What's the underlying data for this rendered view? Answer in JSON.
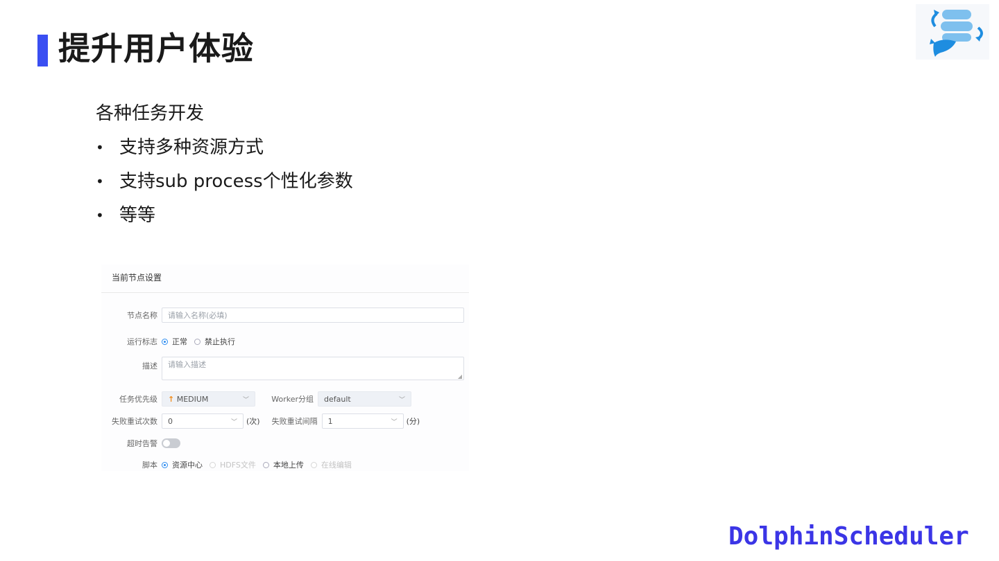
{
  "slide": {
    "title": "提升用户体验",
    "section_heading": "各种任务开发",
    "bullet_glyph": "•",
    "bullets": [
      "支持多种资源方式",
      "支持sub process个性化参数",
      "等等"
    ],
    "brand_text": "DolphinScheduler",
    "colors": {
      "accent": "#3a4ff2",
      "brand": "#3b35e6",
      "radio_active": "#2d8cf0",
      "priority_arrow": "#f28c1b"
    }
  },
  "panel": {
    "header": "当前节点设置",
    "node_name": {
      "label": "节点名称",
      "placeholder": "请输入名称(必填)"
    },
    "run_flag": {
      "label": "运行标志",
      "options": [
        "正常",
        "禁止执行"
      ],
      "selected": "正常"
    },
    "description": {
      "label": "描述",
      "placeholder": "请输入描述"
    },
    "priority": {
      "label": "任务优先级",
      "value": "MEDIUM",
      "icon": "arrow-up-icon"
    },
    "worker_group": {
      "label": "Worker分组",
      "value": "default"
    },
    "retry_times": {
      "label": "失败重试次数",
      "value": "0",
      "unit": "(次)"
    },
    "retry_interval": {
      "label": "失败重试间隔",
      "value": "1",
      "unit": "(分)"
    },
    "timeout_alarm": {
      "label": "超时告警",
      "enabled": false
    },
    "script": {
      "label": "脚本",
      "options": [
        "资源中心",
        "HDFS文件",
        "本地上传",
        "在线编辑"
      ],
      "selected": "资源中心",
      "disabled": [
        "HDFS文件",
        "在线编辑"
      ]
    }
  }
}
